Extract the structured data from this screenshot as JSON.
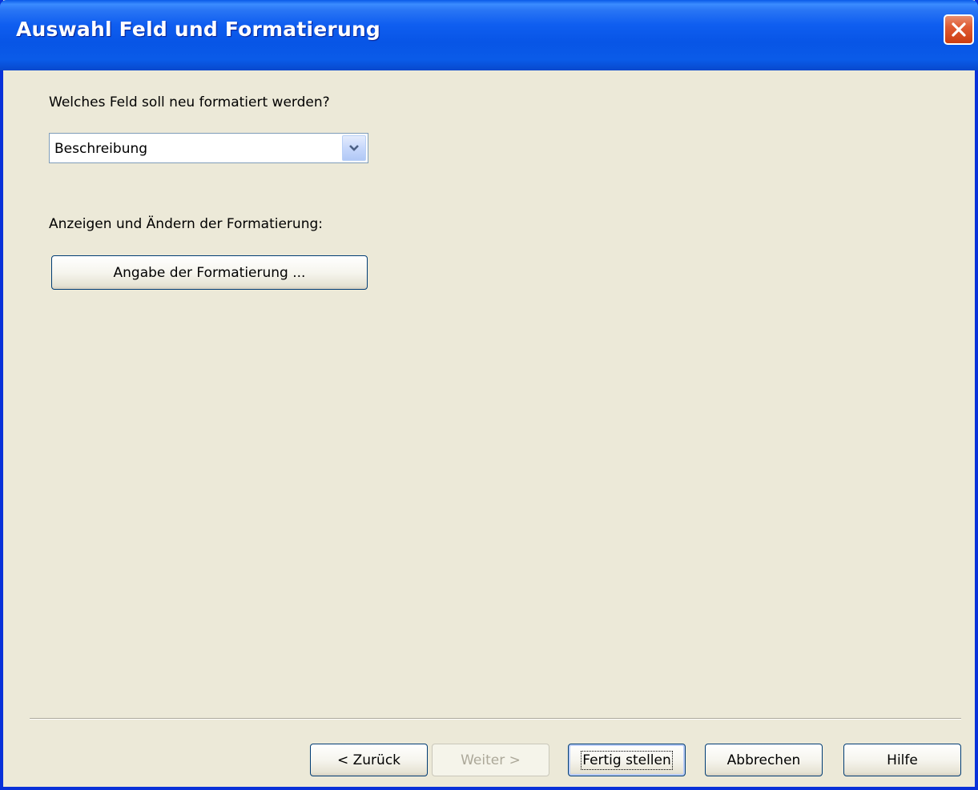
{
  "window": {
    "title": "Auswahl Feld und Formatierung"
  },
  "icons": {
    "close": "close-icon",
    "dropdown": "chevron-down-icon"
  },
  "colors": {
    "titlebar": "#0a5ae8",
    "close_button": "#e05b33",
    "dialog_background": "#ece9d8"
  },
  "field_section": {
    "prompt": "Welches Feld soll neu formatiert werden?",
    "selected_field": "Beschreibung"
  },
  "format_section": {
    "prompt": "Anzeigen und Ändern der Formatierung:",
    "button_label": "Angabe der Formatierung ..."
  },
  "footer": {
    "back_label": "< Zurück",
    "next_label": "Weiter >",
    "finish_label": "Fertig stellen",
    "cancel_label": "Abbrechen",
    "help_label": "Hilfe"
  }
}
